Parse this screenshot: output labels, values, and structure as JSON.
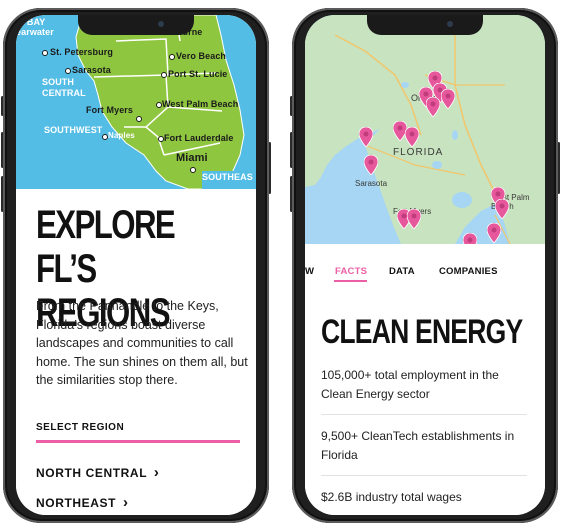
{
  "left_phone": {
    "map": {
      "land_color": "#8fc640",
      "water_color": "#53bde6",
      "labels": {
        "bay": "A BAY",
        "clearwater": "earwater",
        "melbourne": "Melbourne",
        "st_petersburg": "St. Petersburg",
        "vero_beach": "Vero Beach",
        "sarasota": "Sarasota",
        "port_st_lucie": "Port St. Lucie",
        "south": "SOUTH",
        "central": "CENTRAL",
        "west_palm_beach": "West Palm Beach",
        "fort_myers": "Fort Myers",
        "southwest": "SOUTHWEST",
        "naples": "Naples",
        "fort_lauderdale": "Fort Lauderdale",
        "miami": "Miami",
        "southeast": "SOUTHEAS"
      }
    },
    "title": "EXPLORE FL’S REGIONS",
    "body": "From the Panhandle to the Keys, Florida’s regions boast diverse landscapes and communities to call home. The sun shines on them all, but the similarities stop there.",
    "select_label": "SELECT REGION",
    "accent_color": "#ec5fa6",
    "regions": [
      {
        "label": "NORTH CENTRAL",
        "chevron": "›"
      },
      {
        "label": "NORTHEAST",
        "chevron": "›"
      }
    ]
  },
  "right_phone": {
    "map": {
      "land_color": "#c8e3bf",
      "water_color": "#a6d6f3",
      "pin_color": "#e6589b",
      "labels": {
        "orlando": "Orlando",
        "florida": "FLORIDA",
        "sarasota": "Sarasota",
        "fort_myers": "Fort Myers",
        "west_palm_beach": "West Palm Beach"
      }
    },
    "tabs": [
      {
        "label": "W"
      },
      {
        "label": "FACTS"
      },
      {
        "label": "DATA"
      },
      {
        "label": "COMPANIES"
      }
    ],
    "active_tab": "FACTS",
    "title": "CLEAN ENERGY",
    "facts": [
      "105,000+ total employment in the Clean Energy sector",
      "9,500+ CleanTech establishments in Florida",
      "$2.6B industry total wages"
    ]
  }
}
